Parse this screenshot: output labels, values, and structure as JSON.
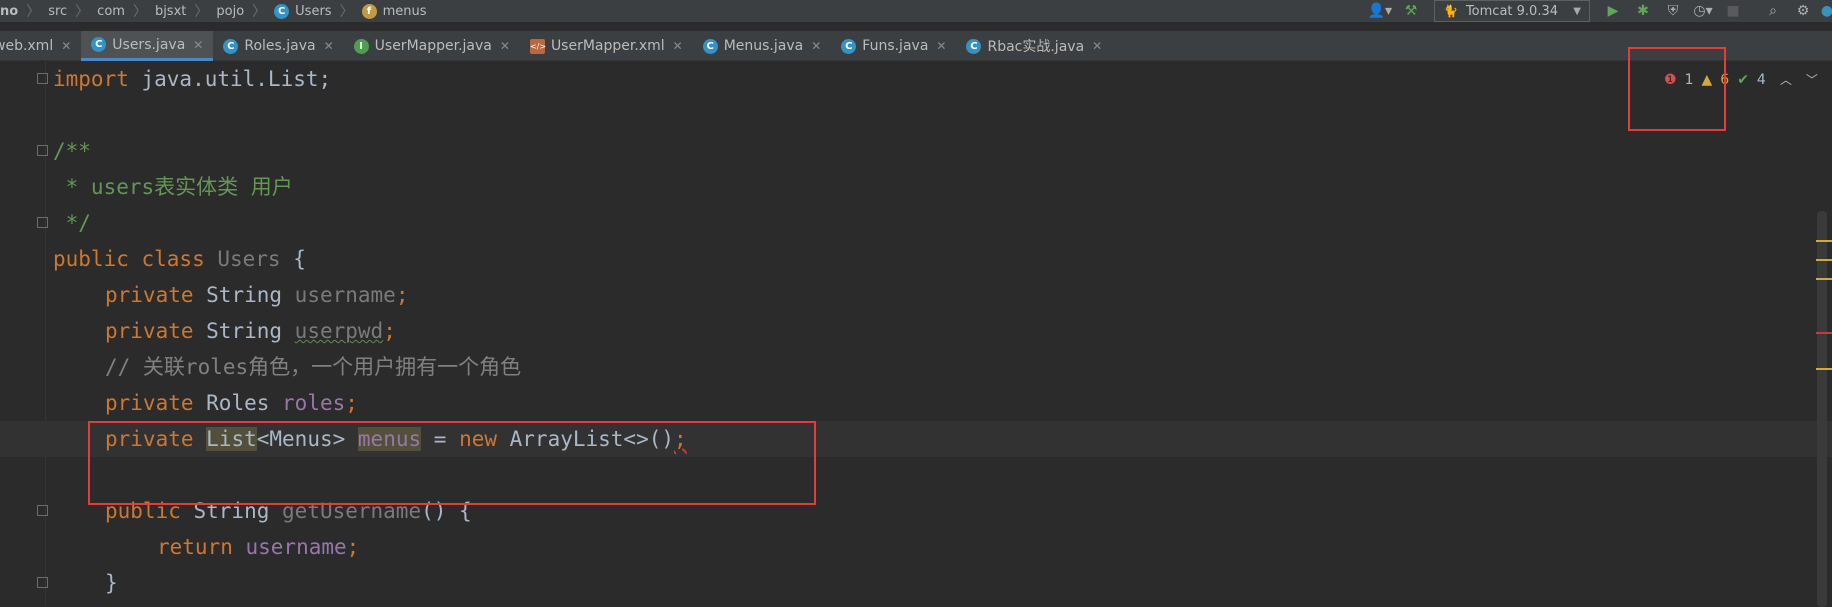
{
  "breadcrumb": {
    "items": [
      "no",
      "src",
      "com",
      "bjsxt",
      "pojo",
      "Users",
      "menus"
    ]
  },
  "toolbar": {
    "run_config": "Tomcat 9.0.34"
  },
  "tabs": [
    {
      "label": "web.xml",
      "icon": "xml-file-icon",
      "active": false
    },
    {
      "label": "Users.java",
      "icon": "class-icon",
      "active": true
    },
    {
      "label": "Roles.java",
      "icon": "class-icon",
      "active": false
    },
    {
      "label": "UserMapper.java",
      "icon": "interface-icon",
      "active": false
    },
    {
      "label": "UserMapper.xml",
      "icon": "xml-file-icon",
      "active": false
    },
    {
      "label": "Menus.java",
      "icon": "class-icon",
      "active": false
    },
    {
      "label": "Funs.java",
      "icon": "class-icon",
      "active": false
    },
    {
      "label": "Rbac实战.java",
      "icon": "class-icon",
      "active": false
    }
  ],
  "inspection": {
    "errors": "1",
    "warnings": "6",
    "typos": "4"
  },
  "code": {
    "l1_kw": "import",
    "l1_rest": " java.util.List;",
    "l3": "/**",
    "l4": " * users表实体类 用户",
    "l5": " */",
    "l6_kw": "public class",
    "l6_name": " Users",
    "l6_rest": " {",
    "l7_kw": "private",
    "l7_type": " String ",
    "l7_field": "username",
    "l7_end": ";",
    "l8_kw": "private",
    "l8_type": " String ",
    "l8_field": "userpwd",
    "l8_end": ";",
    "l9": "// 关联roles角色，一个用户拥有一个角色",
    "l10_kw": "private",
    "l10_type": " Roles ",
    "l10_field": "roles",
    "l10_end": ";",
    "l11_kw": "private",
    "l11_list": "List",
    "l11_generic": "<Menus> ",
    "l11_field": "menus",
    "l11_eq": " = ",
    "l11_new": "new",
    "l11_rest": " ArrayList<>()",
    "l11_end": ";",
    "l13_kw": "public",
    "l13_type": " String ",
    "l13_method": "getUsername",
    "l13_rest": "() {",
    "l14_kw": "return",
    "l14_field": " username",
    "l14_end": ";",
    "l15": "}"
  }
}
